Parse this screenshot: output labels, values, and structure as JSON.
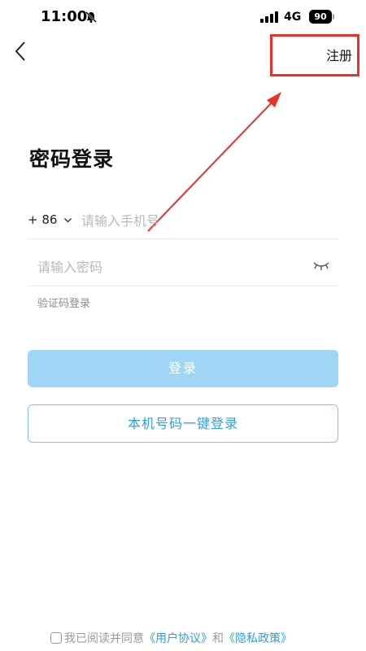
{
  "status_bar": {
    "time": "11:00",
    "network": "4G",
    "battery": "90",
    "icons": [
      "bell-muted-icon",
      "signal-icon",
      "battery-icon"
    ]
  },
  "nav": {
    "back_icon": "chevron-left-icon",
    "register_label": "注册"
  },
  "annotation": {
    "highlight_color": "#e8312b",
    "arrow_color": "#e8312b"
  },
  "title": "密码登录",
  "phone": {
    "country_code": "+ 86",
    "placeholder": "请输入手机号",
    "value": ""
  },
  "password": {
    "placeholder": "请输入密码",
    "value": "",
    "toggle_icon": "eye-closed-icon"
  },
  "sms_login_label": "验证码登录",
  "login_button": {
    "label": "登录",
    "color": "#9fd6f5"
  },
  "onekey_button": {
    "label": "本机号码一键登录",
    "color": "#2f9fdc"
  },
  "agreement": {
    "prefix": "我已阅读并同意",
    "link1": "《用户协议》",
    "connector": "和",
    "link2": "《隐私政策》"
  }
}
